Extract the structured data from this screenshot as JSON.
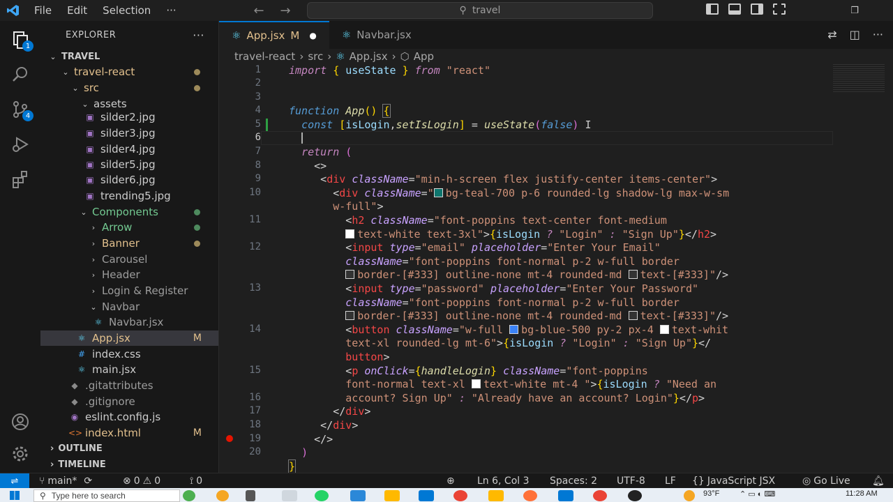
{
  "titlebar": {
    "menu": [
      "File",
      "Edit",
      "Selection",
      "···"
    ],
    "search_text": "travel",
    "colors": {
      "accent": "#0078d4"
    }
  },
  "activity": {
    "explorer_badge": "1",
    "scm_badge": "4"
  },
  "sidebar": {
    "title": "EXPLORER",
    "more": "···",
    "root": "TRAVEL",
    "tree": [
      {
        "label": "travel-react",
        "status": "dot-yellow"
      },
      {
        "label": "src",
        "status": "dot-yellow"
      },
      {
        "label": "assets"
      },
      {
        "label": "silder2.jpg"
      },
      {
        "label": "silder3.jpg"
      },
      {
        "label": "silder4.jpg"
      },
      {
        "label": "silder5.jpg"
      },
      {
        "label": "silder6.jpg"
      },
      {
        "label": "trending5.jpg"
      },
      {
        "label": "Components",
        "status": "dot-green"
      },
      {
        "label": "Arrow",
        "status": "dot-green"
      },
      {
        "label": "Banner",
        "status": "dot-yellow"
      },
      {
        "label": "Carousel"
      },
      {
        "label": "Header"
      },
      {
        "label": "Login & Register"
      },
      {
        "label": "Navbar"
      },
      {
        "label": "Navbar.jsx"
      },
      {
        "label": "App.jsx",
        "status": "M"
      },
      {
        "label": "index.css"
      },
      {
        "label": "main.jsx"
      },
      {
        "label": ".gitattributes"
      },
      {
        "label": ".gitignore"
      },
      {
        "label": "eslint.config.js"
      },
      {
        "label": "index.html",
        "status": "M"
      }
    ],
    "outline": "OUTLINE",
    "timeline": "TIMELINE"
  },
  "tabs": [
    {
      "label": "App.jsx",
      "mod": "M"
    },
    {
      "label": "Navbar.jsx"
    }
  ],
  "breadcrumb": [
    "travel-react",
    "src",
    "App.jsx",
    "App"
  ],
  "editor": {
    "line_numbers": [
      "1",
      "2",
      "3",
      "4",
      "5",
      "6",
      "7",
      "8",
      "9",
      "10",
      "",
      "11",
      "",
      "12",
      "",
      "",
      "13",
      "",
      "",
      "14",
      "",
      "",
      "15",
      "",
      "16",
      "17",
      "18",
      "19",
      "20"
    ]
  },
  "statusbar": {
    "branch": "main*",
    "errors": "0",
    "warnings": "0",
    "ports": "0",
    "position": "Ln 6, Col 3",
    "spaces": "Spaces: 2",
    "encoding": "UTF-8",
    "eol": "LF",
    "language": "JavaScript JSX",
    "golive": "Go Live"
  },
  "taskbar": {
    "search_placeholder": "Type here to search",
    "weather": "93°F",
    "time": "11:28 AM"
  }
}
